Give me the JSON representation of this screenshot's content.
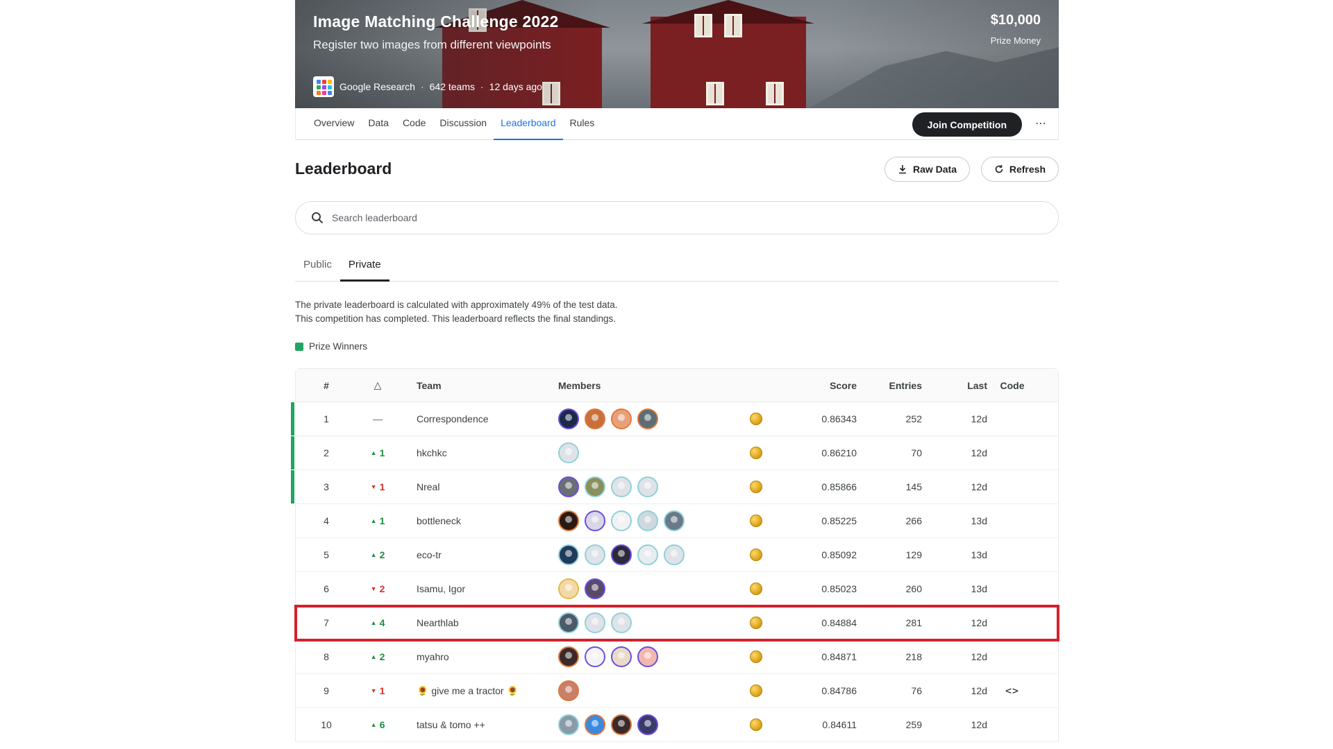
{
  "competition": {
    "title": "Image Matching Challenge 2022",
    "subtitle": "Register two images from different viewpoints",
    "organizer": "Google Research",
    "teams": "642 teams",
    "age": "12 days ago",
    "prize_amount": "$10,000",
    "prize_label": "Prize Money"
  },
  "nav": {
    "tabs": [
      "Overview",
      "Data",
      "Code",
      "Discussion",
      "Leaderboard",
      "Rules"
    ],
    "active": "Leaderboard",
    "join_label": "Join Competition",
    "more_label": "⋯"
  },
  "leaderboard": {
    "title": "Leaderboard",
    "raw_data_label": "Raw Data",
    "refresh_label": "Refresh",
    "search_placeholder": "Search leaderboard",
    "subtabs": [
      "Public",
      "Private"
    ],
    "active_subtab": "Private",
    "desc_line1": "The private leaderboard is calculated with approximately 49% of the test data.",
    "desc_line2": "This competition has completed. This leaderboard reflects the final standings.",
    "legend_label": "Prize Winners",
    "columns": {
      "rank": "#",
      "delta": "△",
      "team": "Team",
      "members": "Members",
      "score": "Score",
      "entries": "Entries",
      "last": "Last",
      "code": "Code"
    },
    "rows": [
      {
        "rank": "1",
        "dir": "same",
        "delta": "—",
        "team": "Correspondence",
        "members": [
          "#1c2a4a",
          "#c7703c",
          "#e8a07a",
          "#5c6e74"
        ],
        "rings": [
          "#6a4de0",
          "#e0763a",
          "#e8763a",
          "#e0763a"
        ],
        "score": "0.86343",
        "entries": "252",
        "last": "12d",
        "code": "",
        "prize": true,
        "highlight": false
      },
      {
        "rank": "2",
        "dir": "up",
        "delta": "1",
        "team": "hkchkc",
        "members": [
          "#dfe3e8"
        ],
        "rings": [
          "#8fd1d8"
        ],
        "score": "0.86210",
        "entries": "70",
        "last": "12d",
        "code": "",
        "prize": true,
        "highlight": false
      },
      {
        "rank": "3",
        "dir": "down",
        "delta": "1",
        "team": "Nreal",
        "members": [
          "#6b6f73",
          "#8a8f5e",
          "#dfe3e8",
          "#dfe3e8"
        ],
        "rings": [
          "#6a4de0",
          "#8fd1d8",
          "#8fd1d8",
          "#8fd1d8"
        ],
        "score": "0.85866",
        "entries": "145",
        "last": "12d",
        "code": "",
        "prize": true,
        "highlight": false
      },
      {
        "rank": "4",
        "dir": "up",
        "delta": "1",
        "team": "bottleneck",
        "members": [
          "#2a1a12",
          "#d9d6e8",
          "#f2f2f2",
          "#cfd8de",
          "#6a7a88"
        ],
        "rings": [
          "#e0763a",
          "#6a4de0",
          "#8fd1d8",
          "#8fd1d8",
          "#8fd1d8"
        ],
        "score": "0.85225",
        "entries": "266",
        "last": "13d",
        "code": "",
        "prize": false,
        "highlight": false
      },
      {
        "rank": "5",
        "dir": "up",
        "delta": "2",
        "team": "eco-tr",
        "members": [
          "#1f3a5a",
          "#dfe3e8",
          "#2a2a3a",
          "#e8ecef",
          "#dfe3e8"
        ],
        "rings": [
          "#8fd1d8",
          "#8fd1d8",
          "#6a4de0",
          "#8fd1d8",
          "#8fd1d8"
        ],
        "score": "0.85092",
        "entries": "129",
        "last": "13d",
        "code": "",
        "prize": false,
        "highlight": false
      },
      {
        "rank": "6",
        "dir": "down",
        "delta": "2",
        "team": "Isamu, Igor",
        "members": [
          "#f4d9a8",
          "#5a4a6a"
        ],
        "rings": [
          "#e8b84a",
          "#6a4de0"
        ],
        "score": "0.85023",
        "entries": "260",
        "last": "13d",
        "code": "",
        "prize": false,
        "highlight": false
      },
      {
        "rank": "7",
        "dir": "up",
        "delta": "4",
        "team": "Nearthlab",
        "members": [
          "#4a5a6a",
          "#dfe3e8",
          "#dfe3e8"
        ],
        "rings": [
          "#8fd1d8",
          "#8fd1d8",
          "#8fd1d8"
        ],
        "score": "0.84884",
        "entries": "281",
        "last": "12d",
        "code": "",
        "prize": false,
        "highlight": true
      },
      {
        "rank": "8",
        "dir": "up",
        "delta": "2",
        "team": "myahro",
        "members": [
          "#3a2a2a",
          "#f4f4f8",
          "#e8dcc8",
          "#f2b8b0"
        ],
        "rings": [
          "#e0763a",
          "#6a4de0",
          "#6a4de0",
          "#6a4de0"
        ],
        "score": "0.84871",
        "entries": "218",
        "last": "12d",
        "code": "",
        "prize": false,
        "highlight": false
      },
      {
        "rank": "9",
        "dir": "down",
        "delta": "1",
        "team": "🌻 give me a tractor 🌻",
        "members": [
          "#c8806a"
        ],
        "rings": [
          "#e0763a"
        ],
        "score": "0.84786",
        "entries": "76",
        "last": "12d",
        "code": "<>",
        "prize": false,
        "highlight": false
      },
      {
        "rank": "10",
        "dir": "up",
        "delta": "6",
        "team": "tatsu & tomo ++",
        "members": [
          "#8a9aa8",
          "#3a8ae0",
          "#3a2a2a",
          "#3a3a6a"
        ],
        "rings": [
          "#8fd1d8",
          "#e0763a",
          "#e0763a",
          "#6a4de0"
        ],
        "score": "0.84611",
        "entries": "259",
        "last": "12d",
        "code": "",
        "prize": false,
        "highlight": false
      }
    ]
  },
  "colors": {
    "accent": "#1a73e8",
    "prize": "#20a464",
    "up": "#1e8e3e",
    "down": "#d93025",
    "highlight": "#d4202a",
    "medal": "#d49a10"
  },
  "icons": {
    "search": "search-icon",
    "download": "download-icon",
    "refresh": "refresh-icon",
    "more": "more-horizontal-icon",
    "medal": "gold-medal-icon",
    "code": "code-icon"
  }
}
